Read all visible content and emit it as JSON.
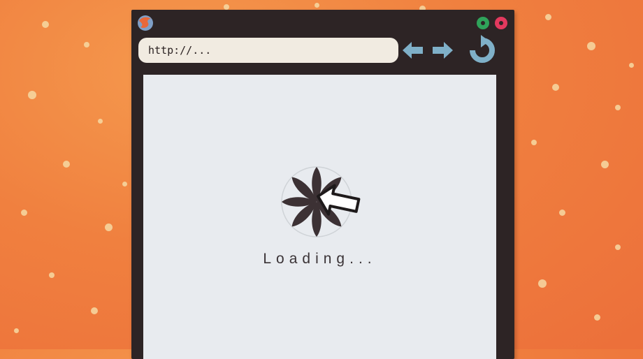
{
  "browser": {
    "address": "http://...",
    "logo_icon": "browser-globe-icon",
    "window_controls": [
      "green",
      "pink"
    ],
    "nav_icons": [
      "back-arrow-icon",
      "forward-arrow-icon",
      "reload-icon"
    ]
  },
  "content": {
    "status_text": "Loading...",
    "spinner_icon": "loading-spinner-icon",
    "cursor_icon": "pointer-cursor-icon"
  },
  "colors": {
    "background": "#f0803f",
    "frame": "#2d2425",
    "viewport": "#e8ebef",
    "accent_blue": "#7fb0c8",
    "green_button": "#2fa35a",
    "pink_button": "#e3395e"
  }
}
